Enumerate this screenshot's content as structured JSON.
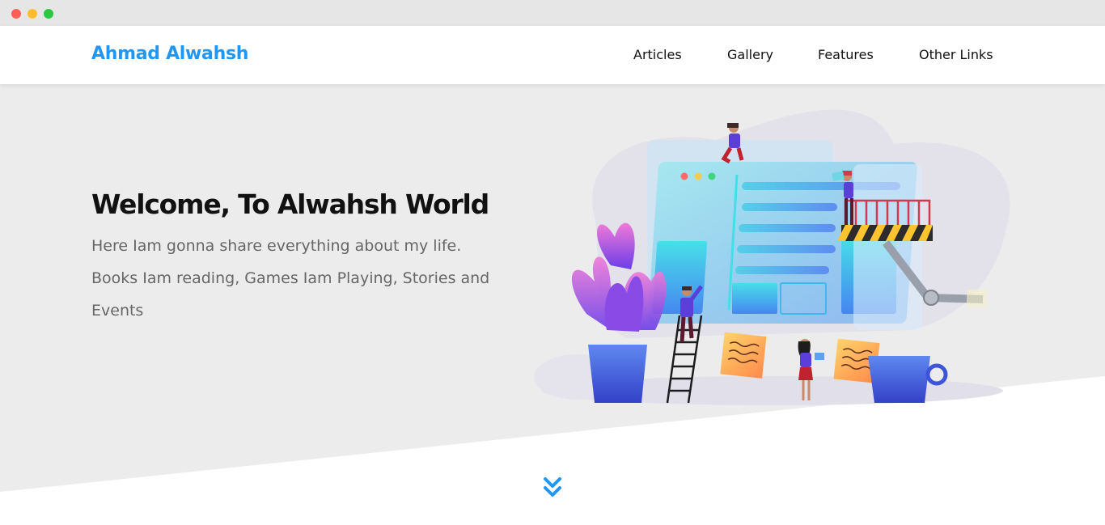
{
  "header": {
    "logo": "Ahmad Alwahsh",
    "nav": [
      "Articles",
      "Gallery",
      "Features",
      "Other Links"
    ]
  },
  "hero": {
    "title": "Welcome, To Alwahsh World",
    "text": "Here Iam gonna share everything about my life. Books Iam reading, Games Iam Playing, Stories and Events"
  },
  "icons": {
    "scroll": "double-chevron-down-icon",
    "illustration": "landing-page-illustration"
  },
  "colors": {
    "accent": "#2196f3",
    "hero_background": "#ececec",
    "title": "#111111",
    "body_text": "#666666"
  }
}
